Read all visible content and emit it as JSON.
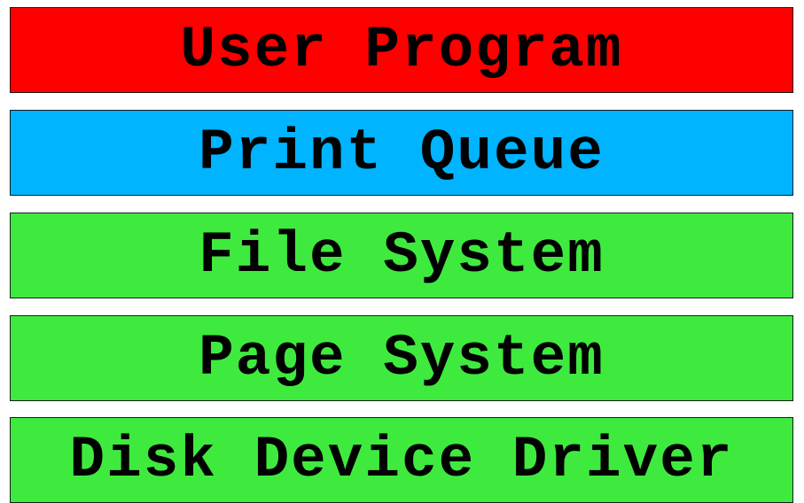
{
  "layers": [
    {
      "label": "User Program",
      "color": "#ff0000"
    },
    {
      "label": "Print Queue",
      "color": "#00b4ff"
    },
    {
      "label": "File System",
      "color": "#3fea3f"
    },
    {
      "label": "Page System",
      "color": "#3fea3f"
    },
    {
      "label": "Disk Device Driver",
      "color": "#3fea3f"
    }
  ]
}
